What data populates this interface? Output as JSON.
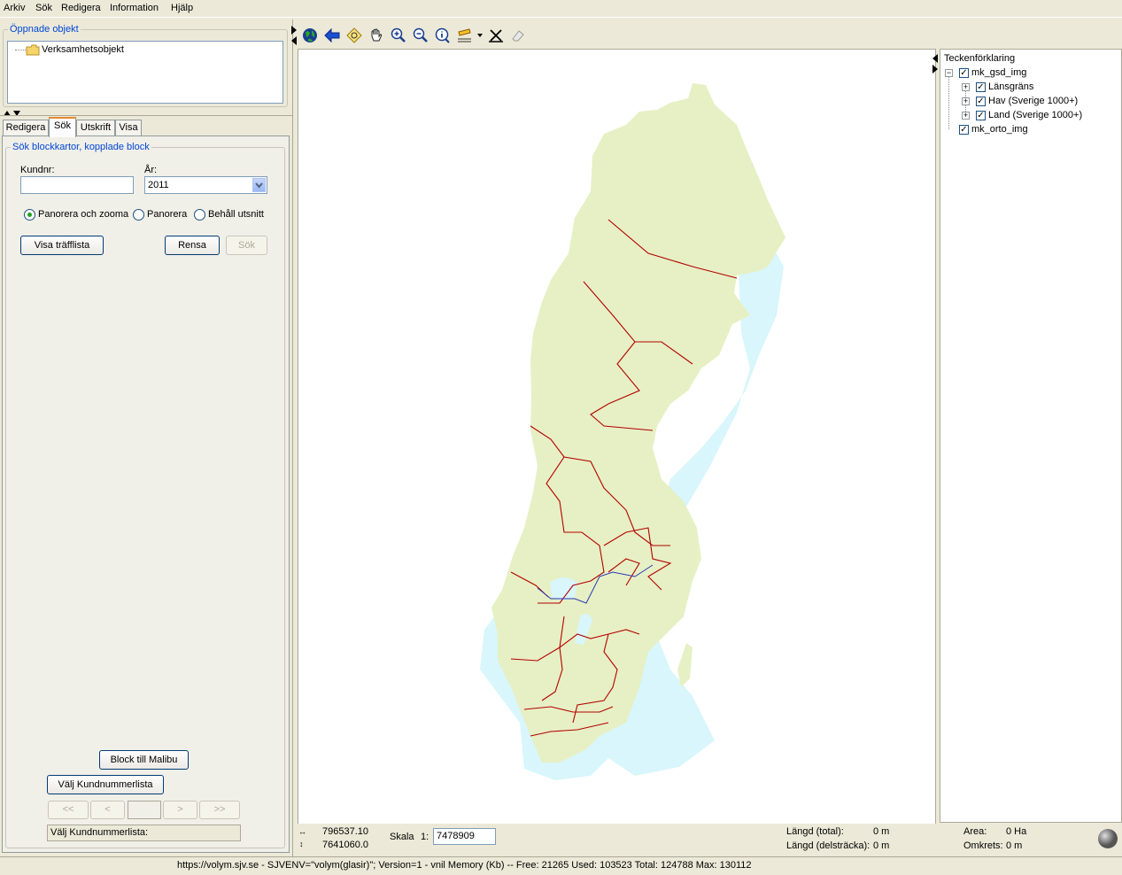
{
  "menu": [
    "Arkiv",
    "Sök",
    "Redigera",
    "Information",
    "Hjälp"
  ],
  "opened_objects": {
    "title": "Öppnade objekt",
    "item": "Verksamhetsobjekt"
  },
  "tabs": [
    {
      "label": "Redigera",
      "active": false
    },
    {
      "label": "Sök",
      "active": true
    },
    {
      "label": "Utskrift",
      "active": false
    },
    {
      "label": "Visa",
      "active": false
    }
  ],
  "search": {
    "title": "Sök blockkartor, kopplade block",
    "kundnr_label": "Kundnr:",
    "kundnr_value": "",
    "year_label": "År:",
    "year_value": "2011",
    "radios": [
      {
        "label": "Panorera och zooma",
        "checked": true
      },
      {
        "label": "Panorera",
        "checked": false
      },
      {
        "label": "Behåll utsnitt",
        "checked": false
      }
    ],
    "show_hits_button": "Visa träfflista",
    "clear_button": "Rensa",
    "search_button": "Sök"
  },
  "bottom_left": {
    "block_button": "Block till Malibu",
    "choose_list_button": "Välj Kundnummerlista",
    "nav": [
      "<<",
      "<",
      "",
      ">",
      ">>"
    ],
    "status_text": "Välj Kundnummerlista:"
  },
  "legend": {
    "title": "Teckenförklaring",
    "layers": [
      {
        "label": "mk_gsd_img",
        "checked": true,
        "level": 0,
        "expandable": true
      },
      {
        "label": "Länsgräns",
        "checked": true,
        "level": 1,
        "expandable": true
      },
      {
        "label": "Hav (Sverige 1000+)",
        "checked": true,
        "level": 1,
        "expandable": true
      },
      {
        "label": "Land (Sverige 1000+)",
        "checked": true,
        "level": 1,
        "expandable": true
      },
      {
        "label": "mk_orto_img",
        "checked": true,
        "level": 0,
        "expandable": false
      }
    ]
  },
  "statusbar": {
    "x_coord": "796537.10",
    "y_coord": "7641060.0",
    "scale_label": "Skala",
    "scale_prefix": "1:",
    "scale_value": "7478909",
    "length_total_label": "Längd (total):",
    "length_total_value": "0 m",
    "length_part_label": "Längd (delsträcka):",
    "length_part_value": "0 m",
    "area_label": "Area:",
    "area_value": "0 Ha",
    "perimeter_label": "Omkrets:",
    "perimeter_value": "0 m"
  },
  "footer": "https://volym.sjv.se - SJVENV=\"volym(glasir)\"; Version=1 - vnil   Memory (Kb) -- Free: 21265  Used: 103523  Total: 124788  Max: 130112",
  "toolbar": [
    "globe-icon",
    "back-arrow-icon",
    "zoom-extent-icon",
    "pan-hand-icon",
    "zoom-in-icon",
    "zoom-out-icon",
    "info-icon",
    "measure-icon",
    "clear-measure-icon",
    "eraser-icon"
  ],
  "colors": {
    "land": "#e6f0c4",
    "sea": "#d8f6fb",
    "border": "#b40000",
    "river": "#2a38b8",
    "accent": "#0046d5"
  }
}
